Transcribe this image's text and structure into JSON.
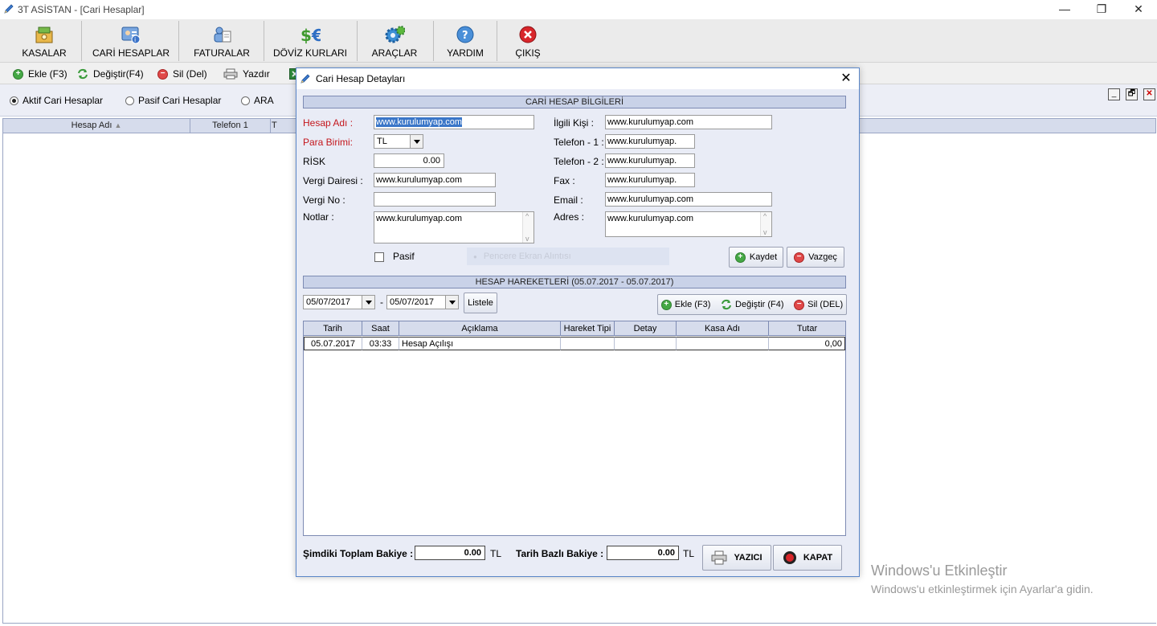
{
  "app": {
    "title": "3T ASİSTAN - [Cari Hesaplar]",
    "window_controls": {
      "minimize": "—",
      "restore": "❐",
      "close": "✕"
    }
  },
  "toolbar": {
    "items": [
      {
        "label": "KASALAR",
        "icon": "cash-box-icon"
      },
      {
        "label": "CARİ HESAPLAR",
        "icon": "accounts-card-icon"
      },
      {
        "label": "FATURALAR",
        "icon": "invoices-icon"
      },
      {
        "label": "DÖVİZ KURLARI",
        "icon": "currency-icon"
      },
      {
        "label": "ARAÇLAR",
        "icon": "tools-gear-icon"
      },
      {
        "label": "YARDIM",
        "icon": "help-icon"
      },
      {
        "label": "ÇIKIŞ",
        "icon": "exit-icon"
      }
    ]
  },
  "subtoolbar": {
    "add": "Ekle (F3)",
    "edit": "Değiştir(F4)",
    "delete": "Sil (Del)",
    "print": "Yazdır"
  },
  "filters": {
    "active": "Aktif Cari Hesaplar",
    "passive": "Pasif Cari Hesaplar",
    "search": "ARA"
  },
  "main_grid": {
    "columns": [
      "Hesap Adı",
      "Telefon 1",
      "T"
    ]
  },
  "mdi_controls": {
    "minimize": "_",
    "restore": "🗗",
    "close": "✕"
  },
  "dialog": {
    "title": "Cari Hesap Detayları",
    "close": "✕",
    "info_section": "CARİ HESAP BİLGİLERİ",
    "fields": {
      "hesap_adi": {
        "label": "Hesap Adı :",
        "value": "www.kurulumyap.com"
      },
      "para_birimi": {
        "label": "Para Birimi:",
        "value": "TL"
      },
      "risk": {
        "label": "RİSK",
        "value": "0.00"
      },
      "vergi_dairesi": {
        "label": "Vergi Dairesi :",
        "value": "www.kurulumyap.com"
      },
      "vergi_no": {
        "label": "Vergi No :",
        "value": ""
      },
      "notlar": {
        "label": "Notlar :",
        "value": "www.kurulumyap.com"
      },
      "ilgili_kisi": {
        "label": "İlgili Kişi :",
        "value": "www.kurulumyap.com"
      },
      "telefon1": {
        "label": "Telefon - 1 :",
        "value": "www.kurulumyap."
      },
      "telefon2": {
        "label": "Telefon - 2 :",
        "value": "www.kurulumyap."
      },
      "fax": {
        "label": "Fax :",
        "value": "www.kurulumyap."
      },
      "email": {
        "label": "Email :",
        "value": "www.kurulumyap.com"
      },
      "adres": {
        "label": "Adres :",
        "value": "www.kurulumyap.com"
      }
    },
    "pasif_label": "Pasif",
    "faded_overlay": "Pencere Ekran Alıntısı",
    "save_button": "Kaydet",
    "cancel_button": "Vazgeç",
    "movements_section": "HESAP HAREKETLERİ (05.07.2017 - 05.07.2017)",
    "date_from": "05/07/2017",
    "date_sep": "-",
    "date_to": "05/07/2017",
    "list_button": "Listele",
    "mv_add": "Ekle (F3)",
    "mv_edit": "Değiştir (F4)",
    "mv_delete": "Sil (DEL)",
    "grid": {
      "columns": [
        "Tarih",
        "Saat",
        "Açıklama",
        "Hareket Tipi",
        "Detay",
        "Kasa Adı",
        "Tutar"
      ],
      "rows": [
        {
          "tarih": "05.07.2017",
          "saat": "03:33",
          "aciklama": "Hesap Açılışı",
          "hareket_tipi": "",
          "detay": "",
          "kasa_adi": "",
          "tutar": "0,00"
        }
      ]
    },
    "current_balance_label": "Şimdiki Toplam Bakiye :",
    "current_balance_value": "0.00",
    "currency1": "TL",
    "date_balance_label": "Tarih Bazlı Bakiye :",
    "date_balance_value": "0.00",
    "currency2": "TL",
    "print_button": "YAZICI",
    "close_button": "KAPAT"
  },
  "watermark": {
    "line1": "Windows'u Etkinleştir",
    "line2": "Windows'u etkinleştirmek için Ayarlar'a gidin."
  }
}
